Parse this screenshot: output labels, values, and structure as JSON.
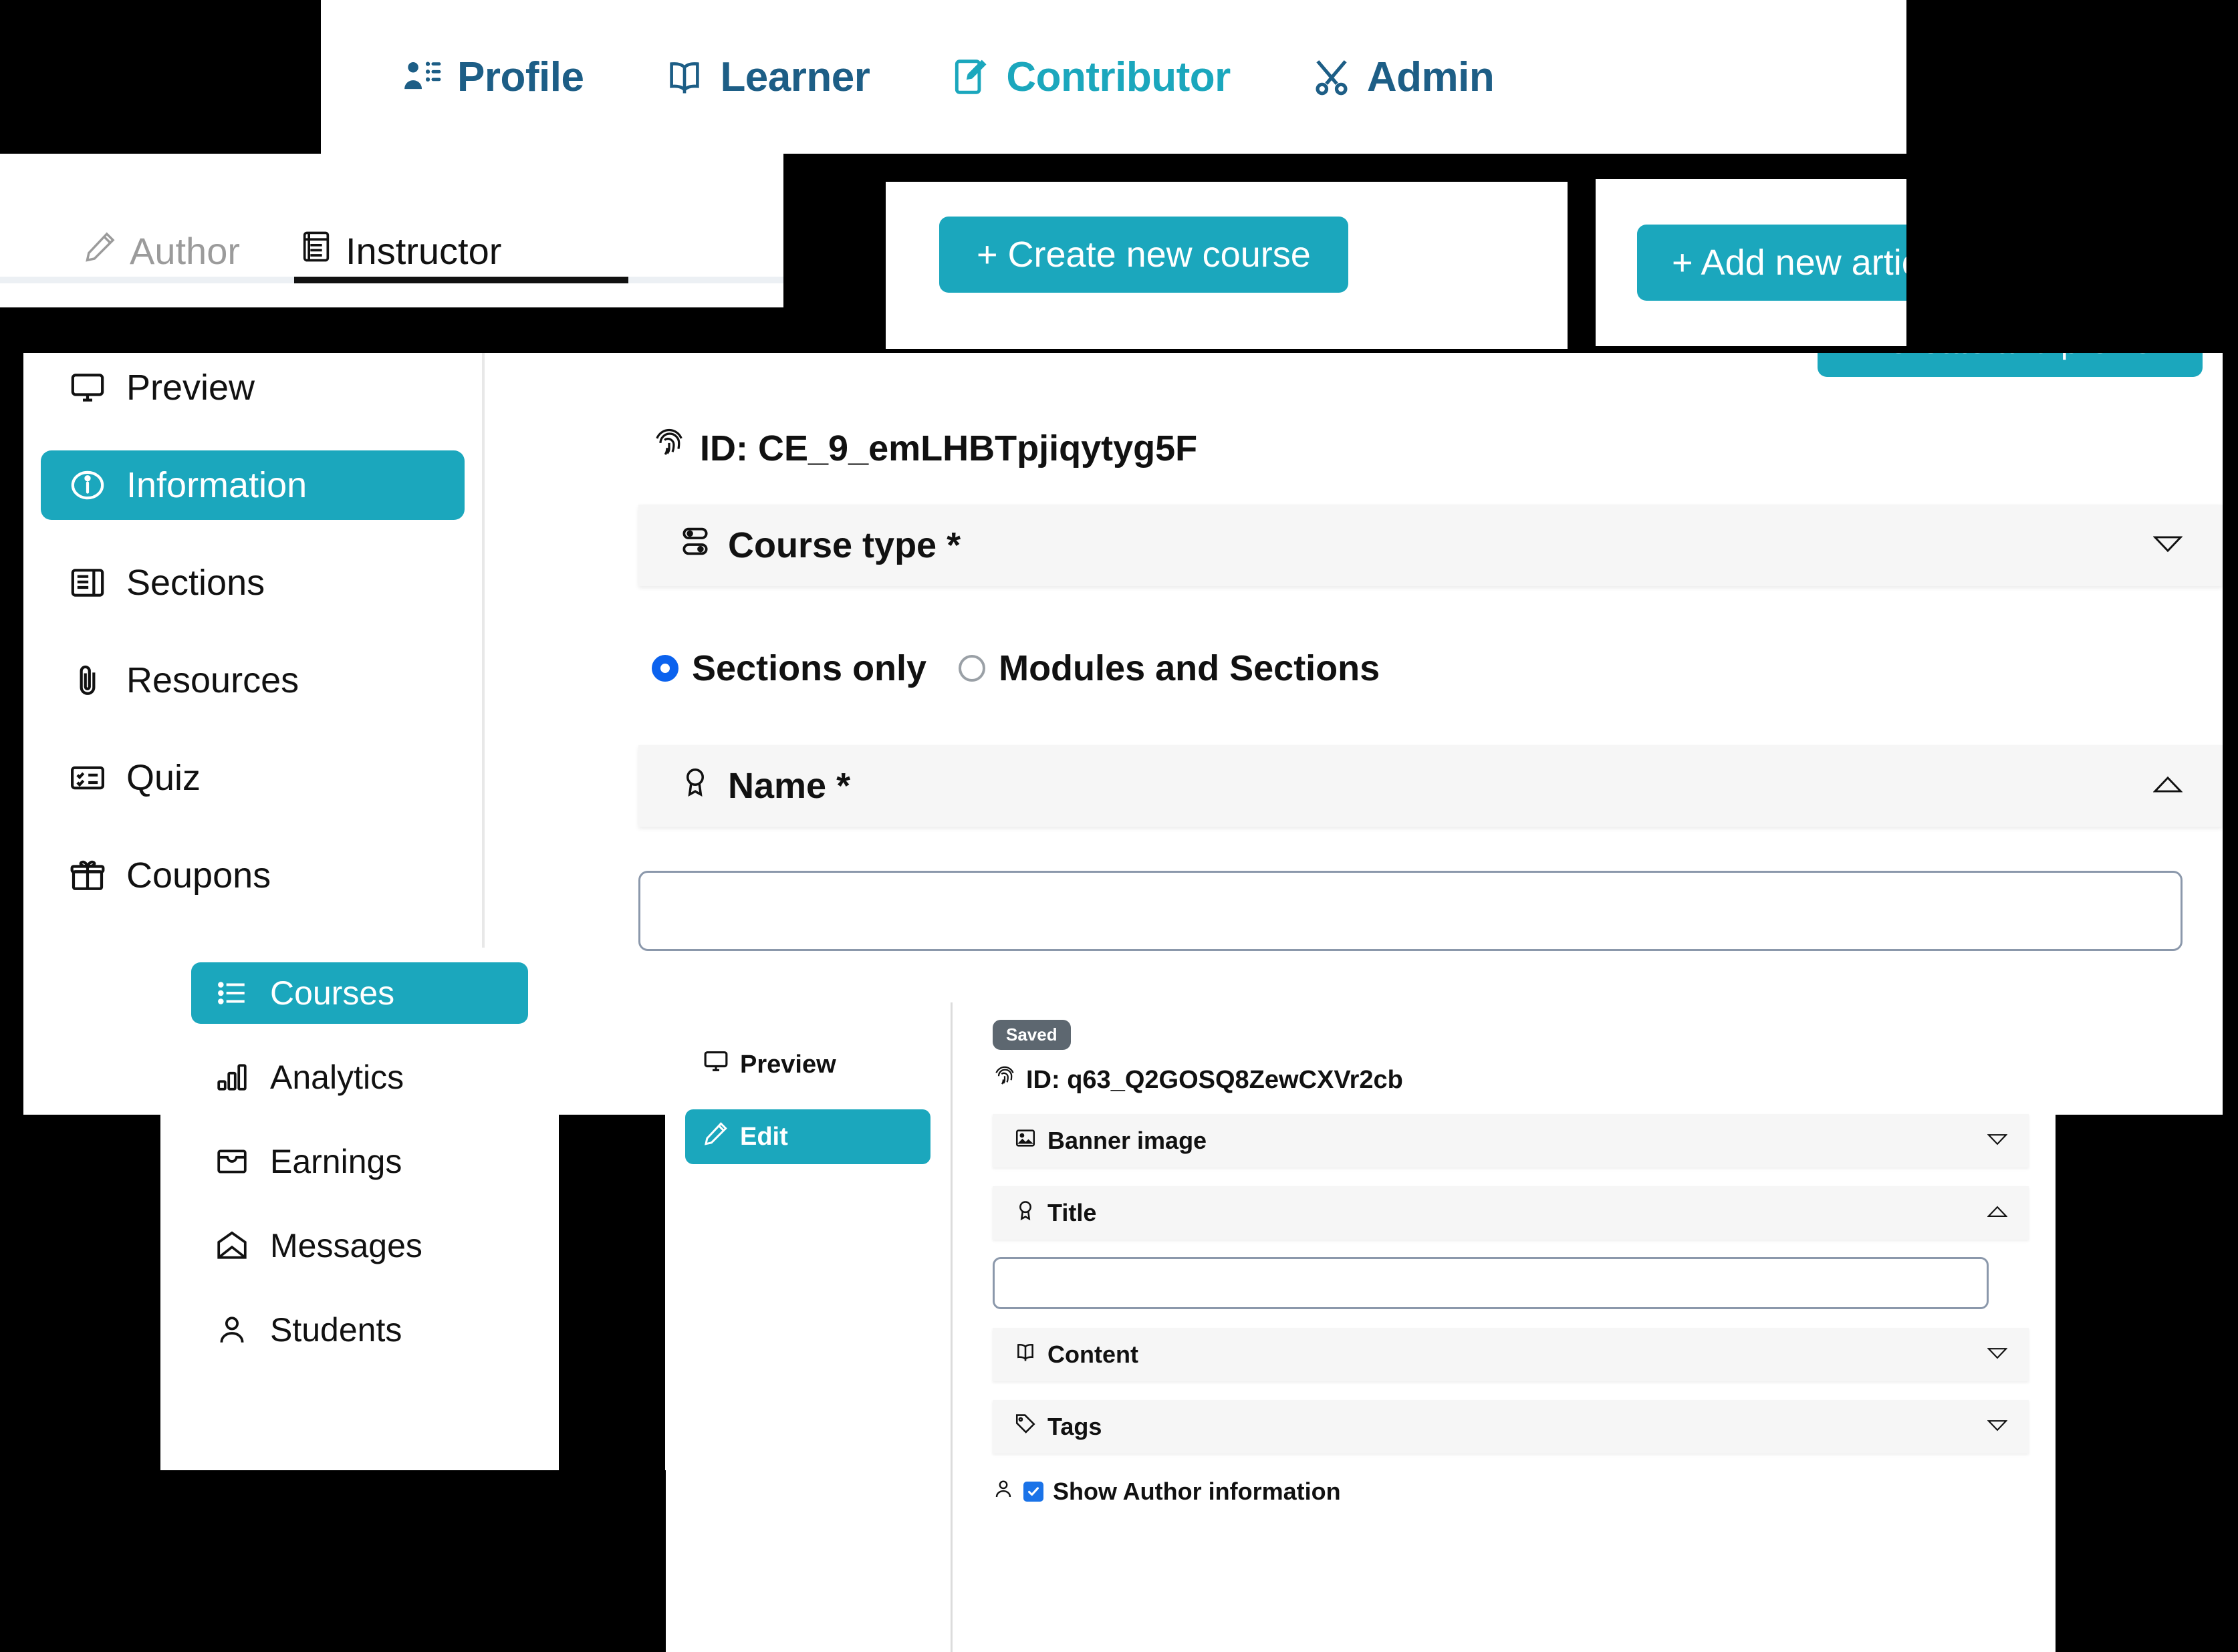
{
  "theme": {
    "accent": "#1ba7bd",
    "nav_blue": "#1d5e86",
    "radio_blue": "#0b62ee",
    "panel_grey": "#f6f6f6"
  },
  "topnav": {
    "items": [
      {
        "label": "Profile",
        "icon": "profile-list-icon",
        "active": false
      },
      {
        "label": "Learner",
        "icon": "open-book-icon",
        "active": false
      },
      {
        "label": "Contributor",
        "icon": "edit-document-icon",
        "active": true
      },
      {
        "label": "Admin",
        "icon": "tools-icon",
        "active": false
      }
    ]
  },
  "subnav": {
    "items": [
      {
        "label": "Author",
        "icon": "pencil-icon",
        "active": false
      },
      {
        "label": "Instructor",
        "icon": "id-card-icon",
        "active": true
      }
    ]
  },
  "actions": {
    "create_course": "+ Create new course",
    "add_article": "+ Add new article",
    "create_and_preview": "Create and preview"
  },
  "sidebar": {
    "items": [
      {
        "label": "Preview",
        "icon": "monitor-icon",
        "active": false
      },
      {
        "label": "Information",
        "icon": "info-icon",
        "active": true
      },
      {
        "label": "Sections",
        "icon": "sections-icon",
        "active": false
      },
      {
        "label": "Resources",
        "icon": "paperclip-icon",
        "active": false
      },
      {
        "label": "Quiz",
        "icon": "quiz-icon",
        "active": false
      },
      {
        "label": "Coupons",
        "icon": "gift-icon",
        "active": false
      }
    ]
  },
  "courses_sidebar": {
    "items": [
      {
        "label": "Courses",
        "icon": "list-icon",
        "active": true
      },
      {
        "label": "Analytics",
        "icon": "bar-chart-icon",
        "active": false
      },
      {
        "label": "Earnings",
        "icon": "wallet-icon",
        "active": false
      },
      {
        "label": "Messages",
        "icon": "envelope-icon",
        "active": false
      },
      {
        "label": "Students",
        "icon": "person-icon",
        "active": false
      }
    ]
  },
  "course": {
    "id_label": "ID: CE_9_emLHBTpjiqytyg5F",
    "course_type": {
      "label": "Course type *",
      "icon": "toggle-icon",
      "expanded": true,
      "options": [
        {
          "label": "Sections only",
          "selected": true
        },
        {
          "label": "Modules and Sections",
          "selected": false
        }
      ]
    },
    "name": {
      "label": "Name *",
      "icon": "badge-icon",
      "expanded": true,
      "value": "",
      "placeholder": ""
    }
  },
  "article": {
    "tabs": [
      {
        "label": "Preview",
        "icon": "monitor-icon",
        "active": false
      },
      {
        "label": "Edit",
        "icon": "pencil-icon",
        "active": true
      }
    ],
    "status_badge": "Saved",
    "id_label": "ID: q63_Q2GOSQ8ZewCXVr2cb",
    "sections": [
      {
        "label": "Banner image",
        "icon": "image-icon",
        "expanded": false
      },
      {
        "label": "Title",
        "icon": "badge-icon",
        "expanded": true
      },
      {
        "label": "Content",
        "icon": "book-icon",
        "expanded": false
      },
      {
        "label": "Tags",
        "icon": "tag-icon",
        "expanded": false
      }
    ],
    "title_value": "",
    "title_placeholder": "",
    "author_checkbox": {
      "label": "Show Author information",
      "checked": true,
      "icon": "person-icon"
    }
  }
}
